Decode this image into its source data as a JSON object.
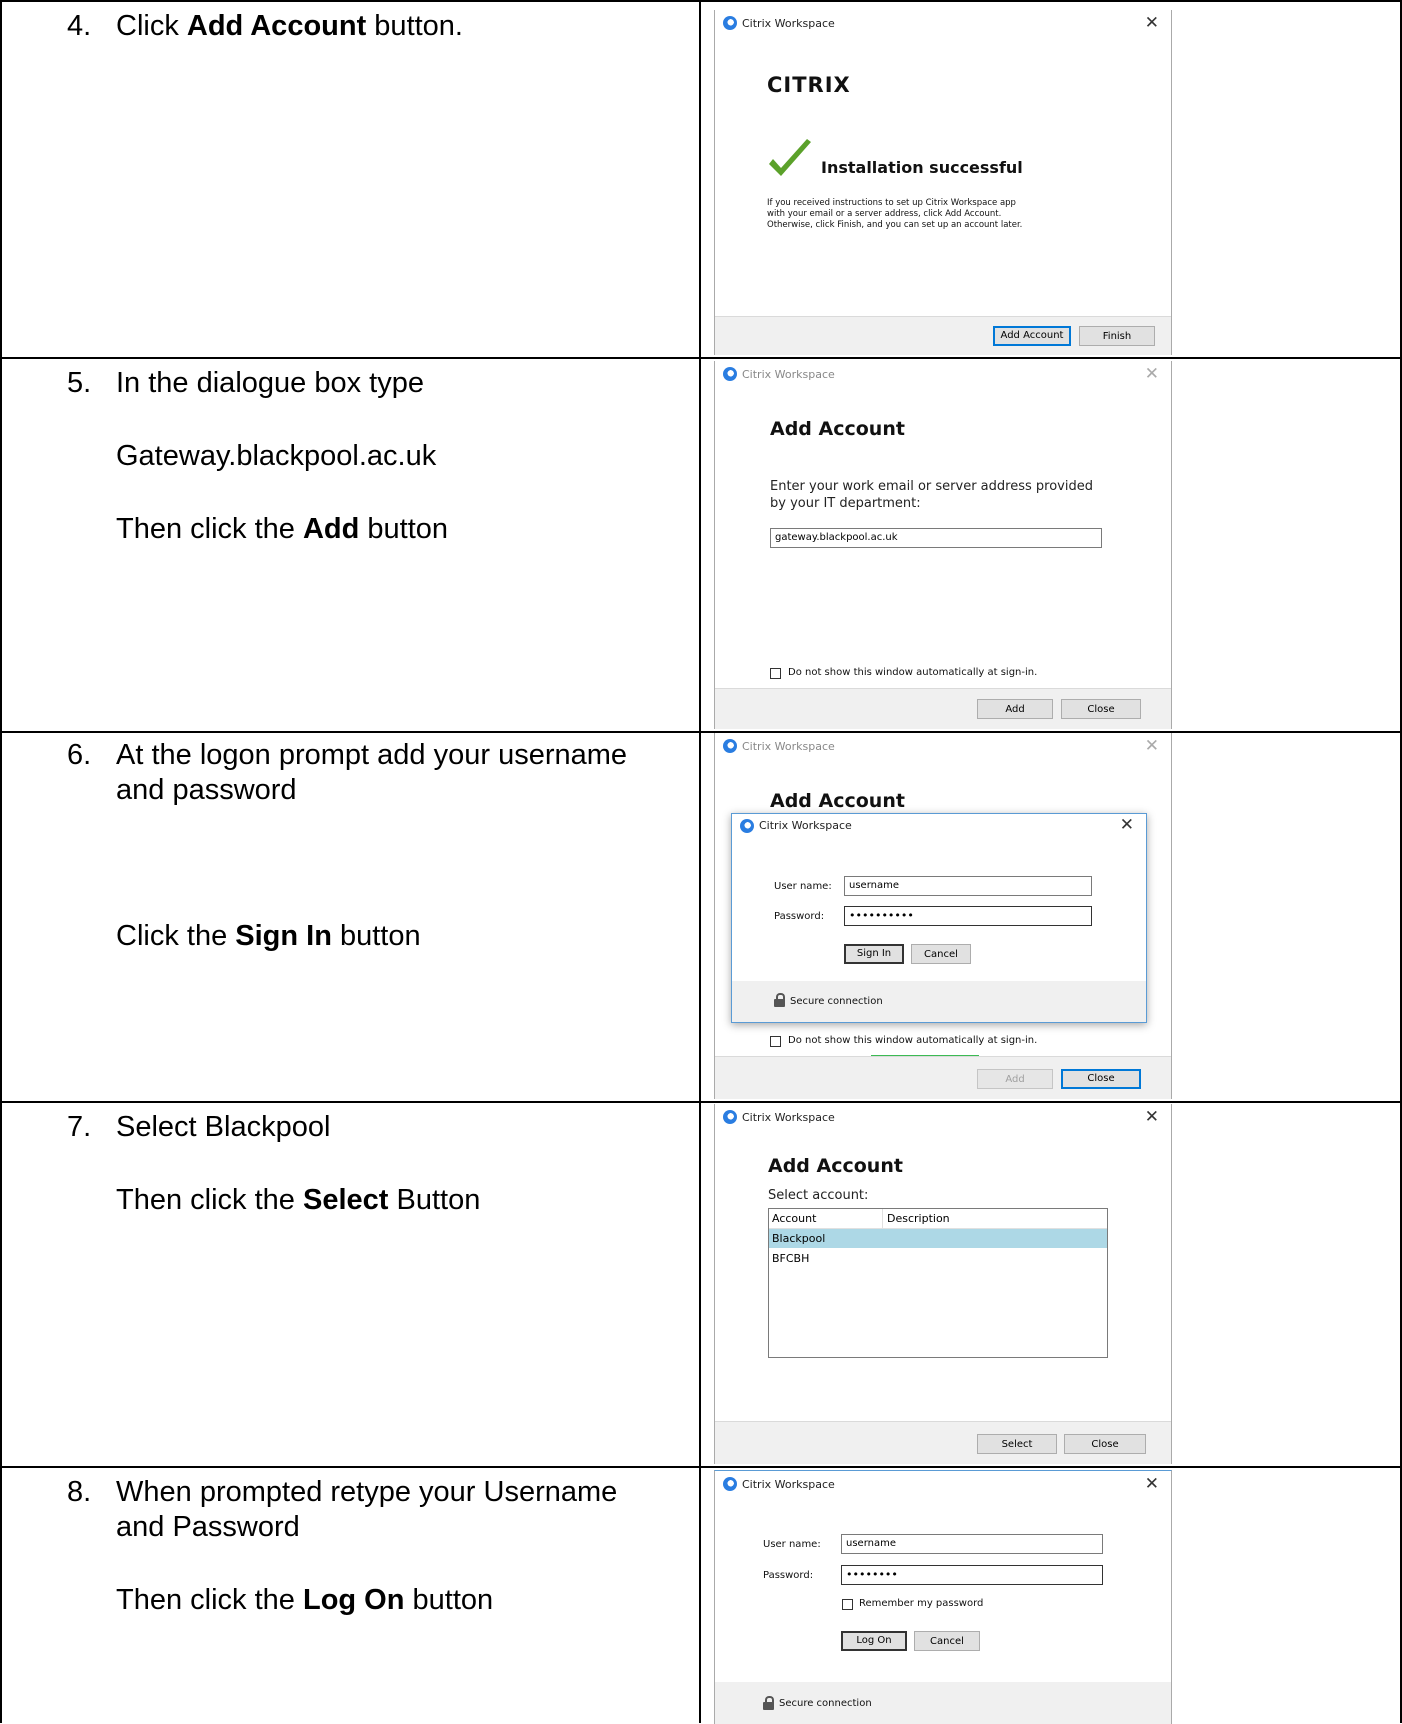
{
  "steps": [
    {
      "num": "4.",
      "parts": [
        "Click ",
        "Add Account",
        " button."
      ]
    },
    {
      "num": "5.",
      "line1": "In the dialogue box type",
      "line2": "Gateway.blackpool.ac.uk",
      "line3_parts": [
        "Then click the ",
        "Add",
        " button"
      ]
    },
    {
      "num": "6.",
      "line1": "At the logon prompt add your username",
      "line1b": "and password",
      "line3_parts": [
        "Click the ",
        "Sign In",
        " button"
      ]
    },
    {
      "num": "7.",
      "line1": "Select Blackpool",
      "line3_parts": [
        "Then click the ",
        "Select",
        " Button"
      ]
    },
    {
      "num": "8.",
      "line1": "When prompted retype your Username",
      "line1b": "and Password",
      "line3_parts": [
        "Then click the ",
        "Log On",
        " button"
      ]
    }
  ],
  "shot1": {
    "title": "Citrix Workspace",
    "brand": "CITRIX",
    "status": "Installation successful",
    "message_lines": [
      "If you received instructions to set up Citrix Workspace app",
      "with your email or a server address, click Add Account.",
      "Otherwise, click Finish, and you can set up an account later."
    ],
    "btn_add_account": "Add Account",
    "btn_finish": "Finish"
  },
  "shot2": {
    "title": "Citrix Workspace",
    "heading": "Add Account",
    "prompt_line1": "Enter your work email or server address provided",
    "prompt_line2": "by your IT department:",
    "input_value": "gateway.blackpool.ac.uk",
    "checkbox_label": "Do not show this window automatically at sign-in.",
    "btn_add": "Add",
    "btn_close": "Close"
  },
  "shot3": {
    "title": "Citrix Workspace",
    "heading": "Add Account",
    "dialog_title": "Citrix Workspace",
    "username_label": "User name:",
    "username_value": "username",
    "password_label": "Password:",
    "password_value": "••••••••••",
    "btn_signin": "Sign In",
    "btn_cancel": "Cancel",
    "secure": "Secure connection",
    "checkbox_label": "Do not show this window automatically at sign-in.",
    "btn_add": "Add",
    "btn_close": "Close"
  },
  "shot4": {
    "title": "Citrix Workspace",
    "heading": "Add Account",
    "select_label": "Select account:",
    "col_account": "Account",
    "col_description": "Description",
    "accounts": [
      "Blackpool",
      "BFCBH"
    ],
    "selected_account": "Blackpool",
    "btn_select": "Select",
    "btn_close": "Close"
  },
  "shot5": {
    "title": "Citrix Workspace",
    "username_label": "User name:",
    "username_value": "username",
    "password_label": "Password:",
    "password_value": "••••••••",
    "remember_label": "Remember my password",
    "btn_logon": "Log On",
    "btn_cancel": "Cancel",
    "secure": "Secure connection"
  },
  "colors": {
    "selection": "#add8e6",
    "accent": "#0078d7",
    "check_green": "#5ba12a",
    "citrix_red": "#d71920"
  }
}
